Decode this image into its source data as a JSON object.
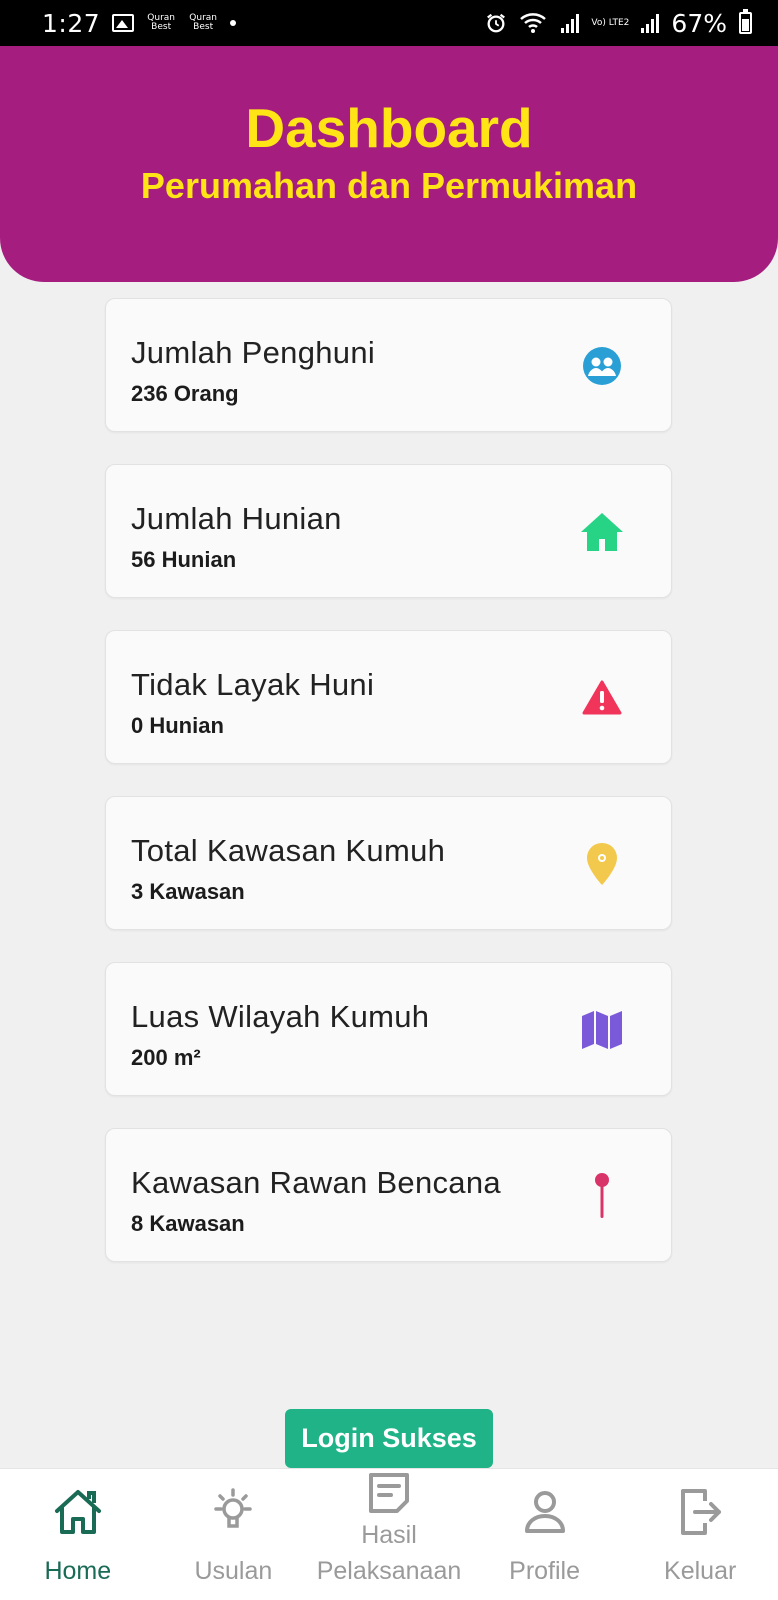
{
  "status_bar": {
    "time": "1:27",
    "quran_1": "Quran Best",
    "quran_2": "Quran Best",
    "network": "Vo) LTE2",
    "battery": "67%"
  },
  "header": {
    "title": "Dashboard",
    "subtitle": "Perumahan dan Permukiman",
    "color": "#a51e7f",
    "text_color": "#ffe516"
  },
  "cards": [
    {
      "title": "Jumlah Penghuni",
      "value": "236 Orang",
      "icon": "users-icon",
      "icon_color": "#2a9fd6"
    },
    {
      "title": "Jumlah Hunian",
      "value": "56 Hunian",
      "icon": "house-icon",
      "icon_color": "#27d486"
    },
    {
      "title": "Tidak Layak Huni",
      "value": "0 Hunian",
      "icon": "warning-icon",
      "icon_color": "#f0345a"
    },
    {
      "title": "Total Kawasan Kumuh",
      "value": "3 Kawasan",
      "icon": "location-pin-icon",
      "icon_color": "#f2c94c"
    },
    {
      "title": "Luas Wilayah Kumuh",
      "value": "200 m²",
      "icon": "map-icon",
      "icon_color": "#7a5ad8"
    },
    {
      "title": "Kawasan Rawan Bencana",
      "value": "8 Kawasan",
      "icon": "map-pin-icon",
      "icon_color": "#d9346a"
    }
  ],
  "toast": {
    "text": "Login Sukses",
    "color": "#1fb387"
  },
  "nav": {
    "home": "Home",
    "usulan": "Usulan",
    "hasil_1": "Hasil",
    "hasil_2": "Pelaksanaan",
    "profile": "Profile",
    "keluar": "Keluar",
    "active_color": "#1a6b55"
  }
}
